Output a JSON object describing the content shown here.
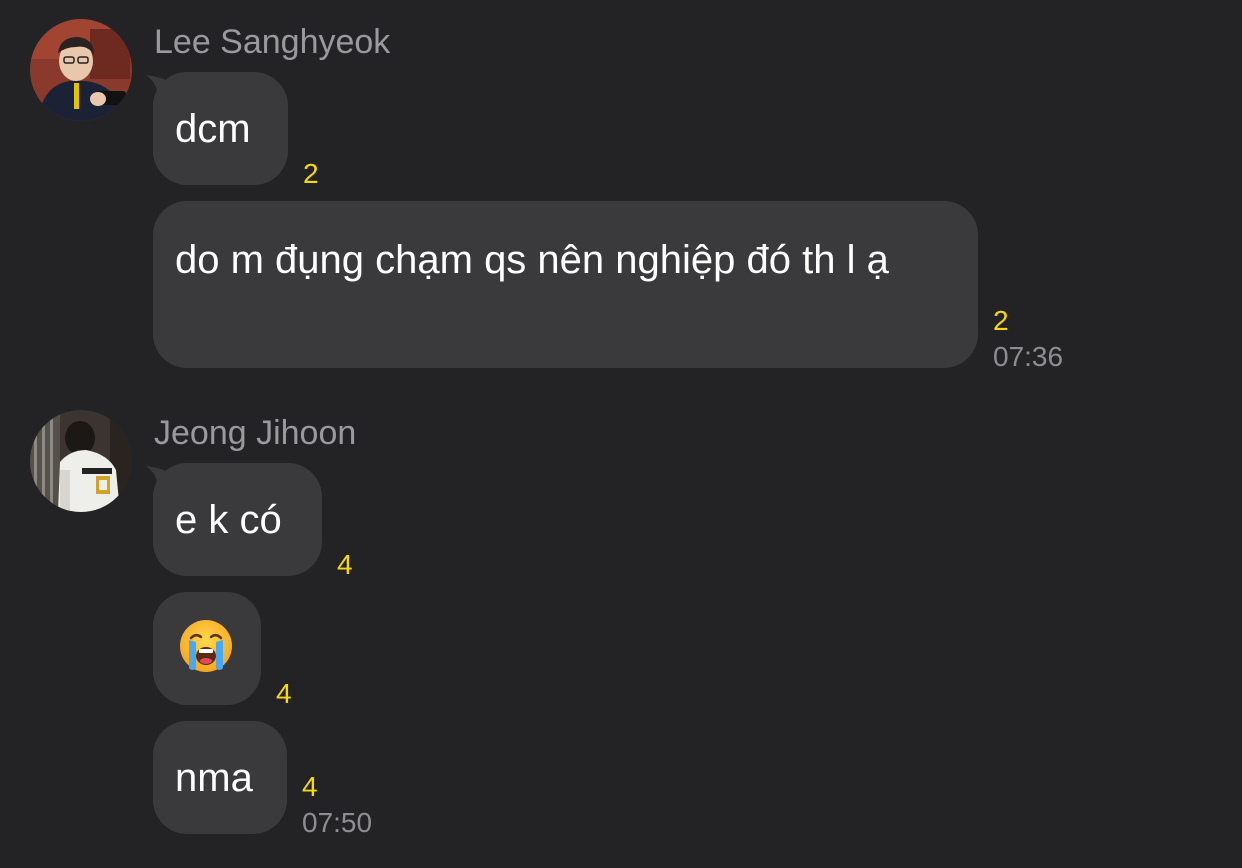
{
  "groups": [
    {
      "sender": "Lee Sanghyeok",
      "avatar": "lee-sanghyeok-avatar",
      "messages": [
        {
          "text": "dcm",
          "unread": "2",
          "time": ""
        },
        {
          "text": "do m đụng chạm qs nên nghiệp đó th l ạ",
          "unread": "2",
          "time": "07:36"
        }
      ]
    },
    {
      "sender": "Jeong Jihoon",
      "avatar": "jeong-jihoon-avatar",
      "messages": [
        {
          "text": "e k có",
          "unread": "4",
          "time": ""
        },
        {
          "emoji": "loudly-crying-face-emoji",
          "unread": "4",
          "time": ""
        },
        {
          "text": "nma",
          "unread": "4",
          "time": "07:50"
        }
      ]
    }
  ],
  "colors": {
    "background": "#232325",
    "bubble": "#3a3a3c",
    "sender_name": "#9a9a9e",
    "unread": "#f5d90a",
    "timestamp": "#8e8e92"
  }
}
